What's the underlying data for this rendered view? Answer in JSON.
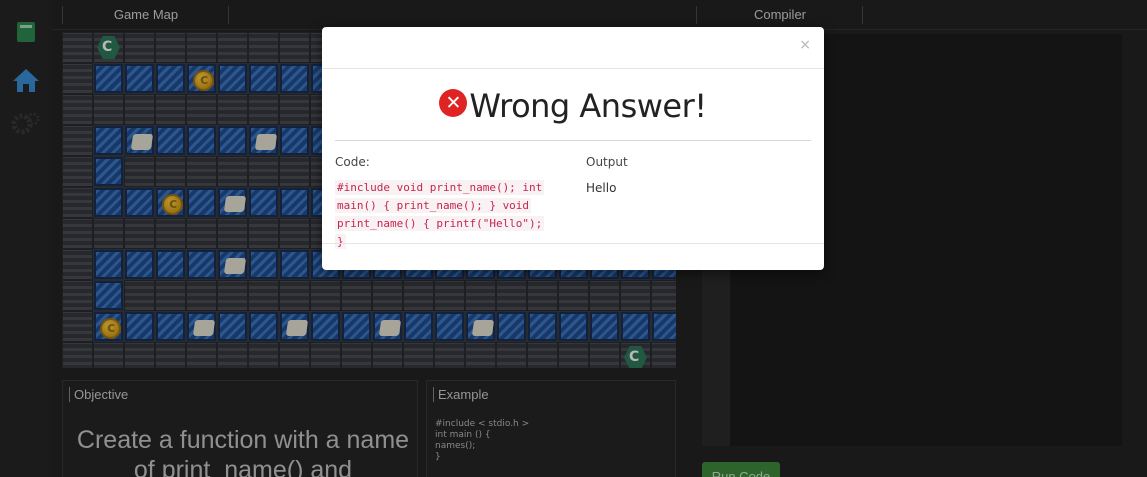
{
  "tabs": {
    "game_map": "Game Map",
    "compiler": "Compiler"
  },
  "sidebar": {
    "items": [
      {
        "icon": "book-icon"
      },
      {
        "icon": "home-icon"
      },
      {
        "icon": "gears-icon"
      }
    ]
  },
  "objective": {
    "title": "Objective",
    "text": "Create a function with a name of print_name() and"
  },
  "example": {
    "title": "Example",
    "code": "#include < stdio.h >\nint main () {\nnames();\n}"
  },
  "compiler": {
    "run_label": "Run Code"
  },
  "modal": {
    "close": "×",
    "result_icon": "error-x-icon",
    "result_label": "Wrong Answer!",
    "code_label": "Code:",
    "output_label": "Output",
    "code": "#include void print_name(); int main() { print_name(); } void print_name() { printf(\"Hello\"); }",
    "output": "Hello"
  },
  "colors": {
    "error": "#e02424",
    "code_text": "#c7254e",
    "run_button": "#3d8b3d"
  }
}
